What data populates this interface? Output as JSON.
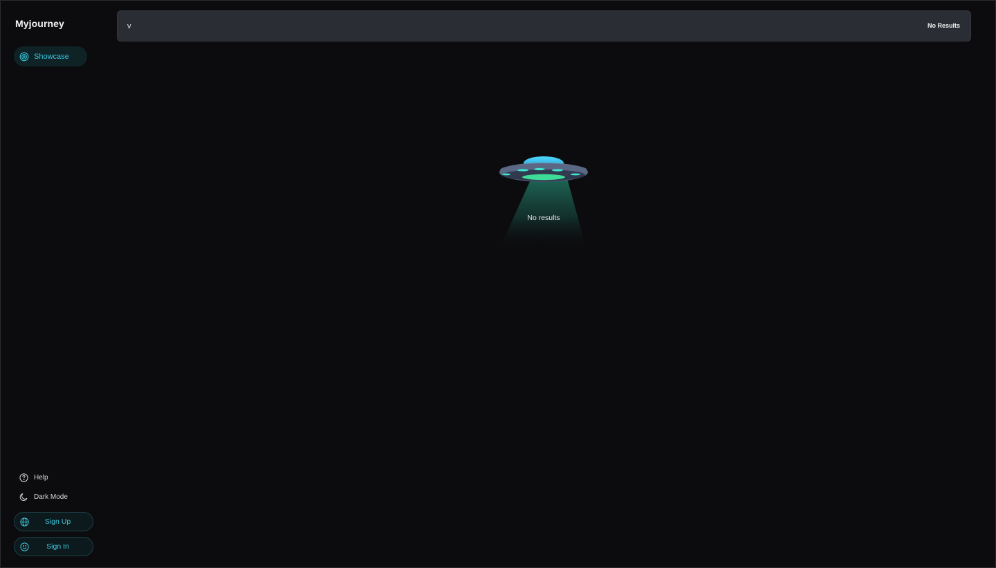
{
  "app": {
    "title": "Myjourney"
  },
  "sidebar": {
    "nav": [
      {
        "label": "Showcase",
        "icon": "target-icon",
        "active": true
      }
    ],
    "links": [
      {
        "label": "Help",
        "icon": "help-circle-icon"
      },
      {
        "label": "Dark Mode",
        "icon": "moon-icon"
      }
    ],
    "buttons": [
      {
        "label": "Sign Up",
        "icon": "globe-icon"
      },
      {
        "label": "Sign In",
        "icon": "smile-icon"
      }
    ]
  },
  "search": {
    "value": "v",
    "status": "No Results"
  },
  "empty_state": {
    "message": "No results",
    "illustration": "ufo-icon"
  },
  "colors": {
    "background": "#0c0c0e",
    "accent": "#35c6dd",
    "search_bg": "#2a2d34",
    "ufo_light": "#3ddc97"
  }
}
